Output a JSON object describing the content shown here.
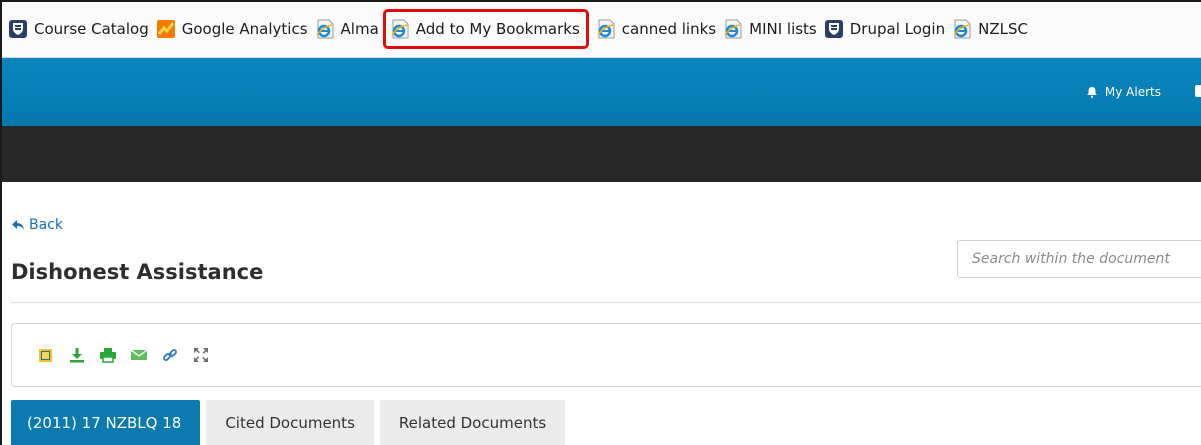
{
  "bookmarks": [
    {
      "label": "Course Catalog",
      "icon": "shield-crest-icon",
      "highlighted": false
    },
    {
      "label": "Google Analytics",
      "icon": "analytics-chart-icon",
      "highlighted": false
    },
    {
      "label": "Alma",
      "icon": "ie-page-icon",
      "highlighted": false
    },
    {
      "label": "Add to My Bookmarks",
      "icon": "ie-page-icon",
      "highlighted": true
    },
    {
      "label": "canned links",
      "icon": "ie-page-icon",
      "highlighted": false
    },
    {
      "label": "MINI lists",
      "icon": "ie-page-icon",
      "highlighted": false
    },
    {
      "label": "Drupal Login",
      "icon": "shield-crest-icon",
      "highlighted": false
    },
    {
      "label": "NZLSC",
      "icon": "ie-page-icon",
      "highlighted": false
    }
  ],
  "header": {
    "alerts_label": "My Alerts"
  },
  "nav": {
    "back_label": "Back"
  },
  "search": {
    "placeholder": "Search within the document"
  },
  "document": {
    "title": "Dishonest Assistance"
  },
  "toolbar": {
    "buttons": [
      "document-icon",
      "download-icon",
      "print-icon",
      "email-icon",
      "link-icon",
      "fullscreen-icon"
    ]
  },
  "tabs": [
    {
      "label": "(2011) 17 NZBLQ 18",
      "active": true
    },
    {
      "label": "Cited Documents",
      "active": false
    },
    {
      "label": "Related Documents",
      "active": false
    }
  ],
  "colors": {
    "highlight": "#e00d0d",
    "blue_nav": "#0a86bf",
    "dark_bar": "#282828",
    "tab_active": "#0a7ab0",
    "link": "#1a73b0"
  }
}
